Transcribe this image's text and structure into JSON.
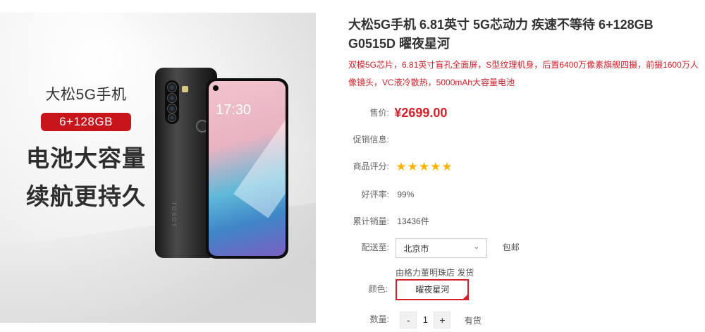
{
  "hero": {
    "brand": "大松5G手机",
    "badge": "6+128GB",
    "line1": "电池大容量",
    "line2": "续航更持久",
    "clock": "17:30",
    "back_logo": "TOSOT"
  },
  "product": {
    "title": "大松5G手机 6.81英寸 5G芯动力 疾速不等待 6+128GB G0515D 曜夜星河",
    "promo": "双模5G芯片，6.81英寸盲孔全面屏，S型纹理机身，后置6400万像素旗舰四摄，前摄1600万人像镜头，VC液冷散热，5000mAh大容量电池"
  },
  "price": {
    "label": "售价:",
    "value": "¥2699.00"
  },
  "promotion": {
    "label": "促销信息:"
  },
  "rating": {
    "label": "商品评分:",
    "stars": 5
  },
  "good_rate": {
    "label": "好评率:",
    "value": "99%"
  },
  "sales": {
    "label": "累计销量:",
    "value": "13436件"
  },
  "delivery": {
    "label": "配送至:",
    "city": "北京市",
    "shipping": "包邮",
    "store": "由格力董明珠店 发货"
  },
  "color": {
    "label": "颜色:",
    "option": "曜夜星河",
    "accent": "#d7202a"
  },
  "quantity": {
    "label": "数量:",
    "minus": "-",
    "value": "1",
    "plus": "+",
    "stock": "有货"
  }
}
